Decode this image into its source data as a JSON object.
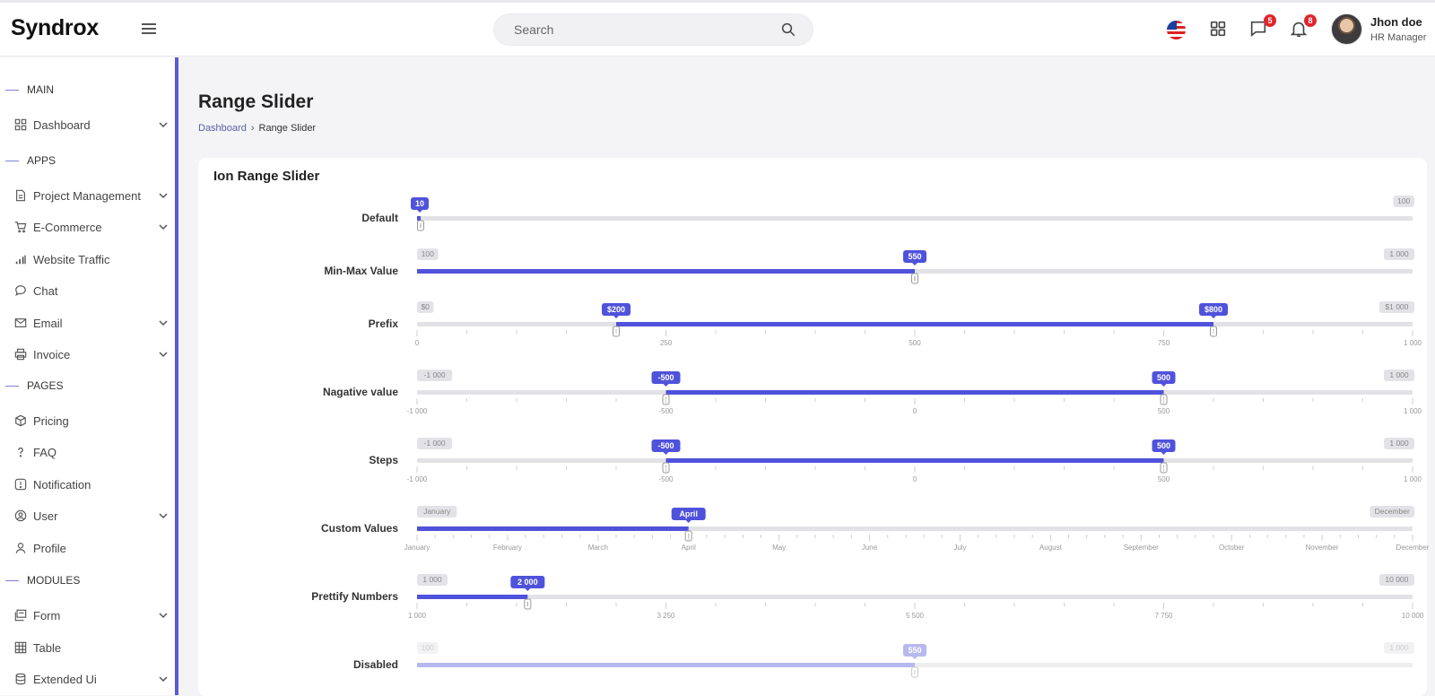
{
  "header": {
    "brand": "Syndrox",
    "search_placeholder": "Search",
    "messages_count": "5",
    "notifications_count": "8",
    "user_name": "Jhon doe",
    "user_role": "HR Manager"
  },
  "sidebar": {
    "sections": {
      "main": "MAIN",
      "apps": "APPS",
      "pages": "PAGES",
      "modules": "MODULES"
    },
    "items": {
      "dashboard": "Dashboard",
      "project_management": "Project Management",
      "ecommerce": "E-Commerce",
      "website_traffic": "Website Traffic",
      "chat": "Chat",
      "email": "Email",
      "invoice": "Invoice",
      "pricing": "Pricing",
      "faq": "FAQ",
      "notification": "Notification",
      "user": "User",
      "profile": "Profile",
      "form": "Form",
      "table": "Table",
      "extended_ui": "Extended Ui"
    }
  },
  "page": {
    "title": "Range Slider",
    "breadcrumb_root": "Dashboard",
    "breadcrumb_current": "Range Slider",
    "card_title": "Ion Range Slider"
  },
  "sliders": [
    {
      "label": "Default",
      "min_label": "",
      "max_label": "100",
      "from_label": "10",
      "to_label": "",
      "from": 0.0,
      "to": null,
      "min_text": "",
      "grid": []
    },
    {
      "label": "Min-Max Value",
      "min_label": "100",
      "max_label": "1 000",
      "from_label": "550",
      "to_label": "",
      "from": 0.5,
      "to": null,
      "grid": []
    },
    {
      "label": "Prefix",
      "min_label": "$0",
      "max_label": "$1 000",
      "from_label": "$200",
      "to_label": "$800",
      "from": 0.2,
      "to": 0.8,
      "grid": [
        "0",
        "250",
        "500",
        "750",
        "1 000"
      ]
    },
    {
      "label": "Nagative value",
      "min_label": "-1 000",
      "max_label": "1 000",
      "from_label": "-500",
      "to_label": "500",
      "from": 0.25,
      "to": 0.75,
      "grid": [
        "-1 000",
        "-500",
        "0",
        "500",
        "1 000"
      ]
    },
    {
      "label": "Steps",
      "min_label": "-1 000",
      "max_label": "1 000",
      "from_label": "-500",
      "to_label": "500",
      "from": 0.25,
      "to": 0.75,
      "grid": [
        "-1 000",
        "-500",
        "0",
        "500",
        "1 000"
      ]
    },
    {
      "label": "Custom Values",
      "min_label": "January",
      "max_label": "December",
      "from_label": "April",
      "to_label": "",
      "from": 0.2727,
      "to": null,
      "grid": [
        "January",
        "February",
        "March",
        "April",
        "May",
        "June",
        "July",
        "August",
        "September",
        "October",
        "November",
        "December"
      ]
    },
    {
      "label": "Prettify Numbers",
      "min_label": "1 000",
      "max_label": "10 000",
      "from_label": "2 000",
      "to_label": "",
      "from": 0.1111,
      "to": null,
      "grid": [
        "1 000",
        "3 250",
        "5 500",
        "7 750",
        "10 000"
      ]
    },
    {
      "label": "Disabled",
      "min_label": "100",
      "max_label": "1 000",
      "from_label": "550",
      "to_label": "",
      "from": 0.5,
      "to": null,
      "disabled": true,
      "grid": []
    }
  ],
  "colors": {
    "accent": "#4f52db",
    "accent_light": "#b7b8ee",
    "sidebar_border": "#5b5bd6",
    "badge": "#e0262d"
  }
}
